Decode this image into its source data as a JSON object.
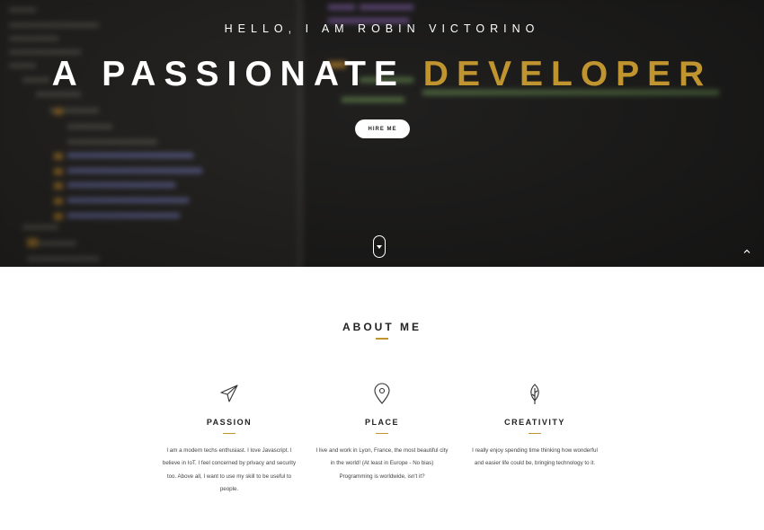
{
  "hero": {
    "greeting": "HELLO, I AM ROBIN VICTORINO",
    "headline_main": "A PASSIONATE",
    "headline_accent": "DEVELOPER",
    "hire_button": "HIRE ME",
    "accent_color": "#c0942f",
    "scroll_down_icon": "chevron-down-icon",
    "scroll_up_icon": "chevron-up-icon"
  },
  "about": {
    "title": "ABOUT ME",
    "features": [
      {
        "icon": "paper-plane-icon",
        "title": "PASSION",
        "text": "I am a modern techs enthusiast. I love Javascript. I believe in IoT. I feel concerned by privacy and security too. Above all, I want to use my skill to be useful to people."
      },
      {
        "icon": "map-pin-icon",
        "title": "PLACE",
        "text": "I live and work in Lyon, France, the most beautiful city in the world! (At least in Europe - No bias) Programming is worldwide, isn't it?"
      },
      {
        "icon": "leaf-icon",
        "title": "CREATIVITY",
        "text": "I really enjoy spending time thinking how wonderful and easier life could be, bringing technology to it."
      }
    ]
  }
}
